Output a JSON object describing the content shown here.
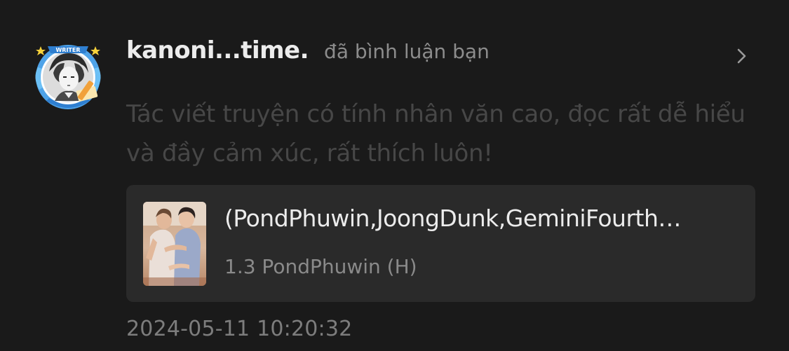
{
  "notification": {
    "username": "kanoni...time.",
    "action": "đã bình luận bạn",
    "comment": "Tác viết truyện có tính nhân văn cao, đọc rất dễ hiểu và đầy cảm xúc, rất thích luôn!",
    "story": {
      "title": "(PondPhuwin,JoongDunk,GeminiFourth…",
      "chapter": "1.3 PondPhuwin (H)"
    },
    "timestamp": "2024-05-11 10:20:32",
    "avatar_badge": "WRITER"
  },
  "icons": {
    "chevron": "chevron-right-icon",
    "avatar": "writer-badge-avatar"
  },
  "colors": {
    "background": "#1a1a1a",
    "card": "#2a2a2a",
    "primary_text": "#ececec",
    "secondary_text": "#8c8c8c",
    "comment_text": "#474747",
    "badge_blue": "#4fa3e8"
  }
}
